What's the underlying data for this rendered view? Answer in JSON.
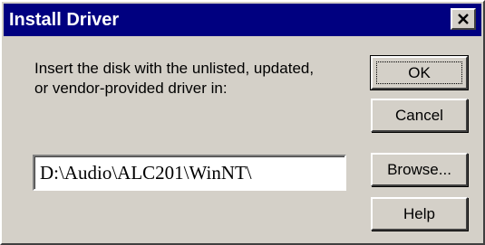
{
  "window": {
    "title": "Install Driver",
    "close_icon": "close-icon"
  },
  "message": {
    "line1": "Insert the disk with the unlisted, updated,",
    "line2": "or vendor-provided driver in:"
  },
  "path_input": {
    "value": "D:\\Audio\\ALC201\\WinNT\\"
  },
  "buttons": {
    "ok": "OK",
    "cancel": "Cancel",
    "browse": "Browse...",
    "help": "Help"
  },
  "colors": {
    "titlebar": "#000080",
    "face": "#d4d0c8"
  }
}
